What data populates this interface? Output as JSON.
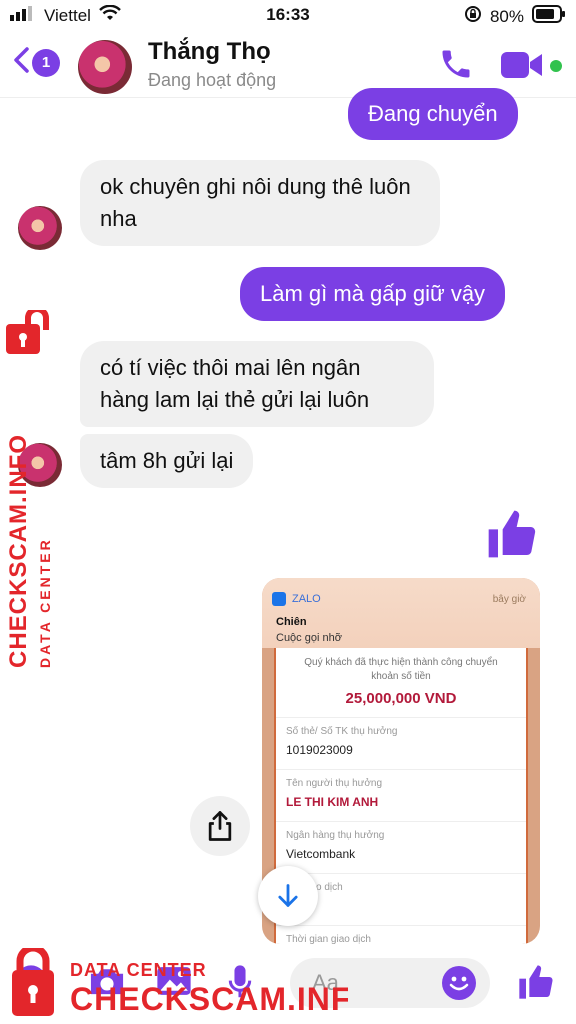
{
  "status_bar": {
    "carrier": "Viettel",
    "time": "16:33",
    "battery": "80%"
  },
  "header": {
    "back_count": "1",
    "contact_name": "Thắng Thọ",
    "presence": "Đang hoạt động"
  },
  "messages": [
    {
      "side": "out",
      "text": "Đang chuyển"
    },
    {
      "side": "in",
      "text": "ok chuyên ghi nôi dung thê luôn nha"
    },
    {
      "side": "out",
      "text": "Làm gì mà gấp giữ vậy"
    },
    {
      "side": "in",
      "text": "có tí việc thôi mai lên ngân hàng lam lại thẻ gửi lại luôn"
    },
    {
      "side": "in",
      "text": "tâm 8h gửi lại"
    },
    {
      "side": "out",
      "type": "sticker",
      "icon": "thumbs-up-icon"
    }
  ],
  "shared_image": {
    "notification": {
      "app": "ZALO",
      "time": "bây giờ",
      "sender": "Chiên",
      "text": "Cuộc gọi nhỡ"
    },
    "receipt": {
      "confirmation": "Quý khách đã thực hiện thành công chuyển khoản số tiền",
      "amount": "25,000,000 VND",
      "fields": [
        {
          "label": "Số thẻ/ Số TK thụ hưởng",
          "value": "1019023009"
        },
        {
          "label": "Tên người thụ hưởng",
          "value": "LE THI KIM ANH"
        },
        {
          "label": "Ngân hàng thụ hưởng",
          "value": "Vietcombank"
        },
        {
          "label": "Mã giao dịch",
          "value": ""
        },
        {
          "label": "Thời gian giao dịch",
          "value": ""
        }
      ]
    }
  },
  "composer": {
    "placeholder": "Aa"
  },
  "watermark": {
    "line1": "DATA CENTER",
    "line2": "CHECKSCAM.INFO"
  },
  "colors": {
    "accent": "#7b3fe4",
    "incoming_bubble": "#f0f0f0",
    "watermark": "#e3262b",
    "online": "#31c24d"
  }
}
